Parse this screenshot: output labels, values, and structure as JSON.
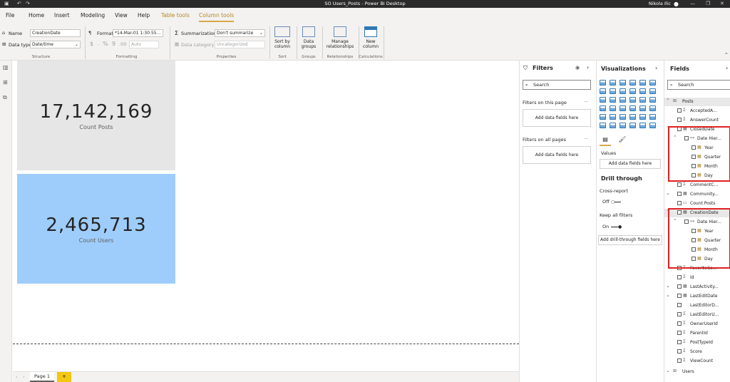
{
  "window": {
    "title": "SO Users_Posts - Power BI Desktop",
    "user": "Nikola Ilic"
  },
  "menu": {
    "file": "File",
    "home": "Home",
    "insert": "Insert",
    "modeling": "Modeling",
    "view": "View",
    "help": "Help",
    "table_tools": "Table tools",
    "column_tools": "Column tools"
  },
  "ribbon": {
    "name_label": "Name",
    "name_value": "CreationDate",
    "datatype_label": "Data type",
    "datatype_value": "Date/time",
    "structure": "Structure",
    "format_label": "Format",
    "format_value": "*14-Mar-01 1:30:55...",
    "currency": "$",
    "percent": "%",
    "comma": "9",
    "decimals": ".00",
    "auto": "Auto",
    "formatting": "Formatting",
    "summarization_label": "Summarization",
    "summarization_value": "Don't summarize",
    "datacategory_label": "Data category",
    "datacategory_value": "Uncategorized",
    "properties": "Properties",
    "sort_label": "Sort by column",
    "sort_group": "Sort",
    "datagroups_label": "Data groups",
    "groups_group": "Groups",
    "relationships_label": "Manage relationships",
    "relationships_group": "Relationships",
    "newcolumn_label": "New column",
    "calculations_group": "Calculations"
  },
  "cards": [
    {
      "value": "17,142,169",
      "label": "Count Posts",
      "bg": "#e6e6e6"
    },
    {
      "value": "2,465,713",
      "label": "Count Users",
      "bg": "#9fcdfb"
    }
  ],
  "pages": {
    "page1": "Page 1",
    "add": "+"
  },
  "filters": {
    "title": "Filters",
    "search": "Search",
    "on_page": "Filters on this page",
    "add1": "Add data fields here",
    "on_all": "Filters on all pages",
    "add2": "Add data fields here",
    "more": "···"
  },
  "viz": {
    "title": "Visualizations",
    "values": "Values",
    "add_values": "Add data fields here",
    "drill": "Drill through",
    "cross_report": "Cross-report",
    "off": "Off",
    "keep_filters": "Keep all filters",
    "on": "On",
    "add_drill": "Add drill-through fields here"
  },
  "fields": {
    "title": "Fields",
    "search": "Search",
    "tables": [
      {
        "name": "Posts"
      },
      {
        "name": "Users"
      }
    ],
    "posts_items": [
      "AcceptedA...",
      "AnswerCount",
      "ClosedDate",
      "Date Hier...",
      "Year",
      "Quarter",
      "Month",
      "Day",
      "CommentC...",
      "Community...",
      "Count Posts",
      "CreationDate",
      "Date Hier...",
      "Year",
      "Quarter",
      "Month",
      "Day",
      "FavoriteCo...",
      "Id",
      "LastActivity...",
      "LastEditDate",
      "LastEditorD...",
      "LastEditorU...",
      "OwnerUserId",
      "ParentId",
      "PostTypeId",
      "Score",
      "ViewCount"
    ]
  },
  "colors": {
    "accent": "#d9a84a",
    "highlight": "#e02020"
  }
}
